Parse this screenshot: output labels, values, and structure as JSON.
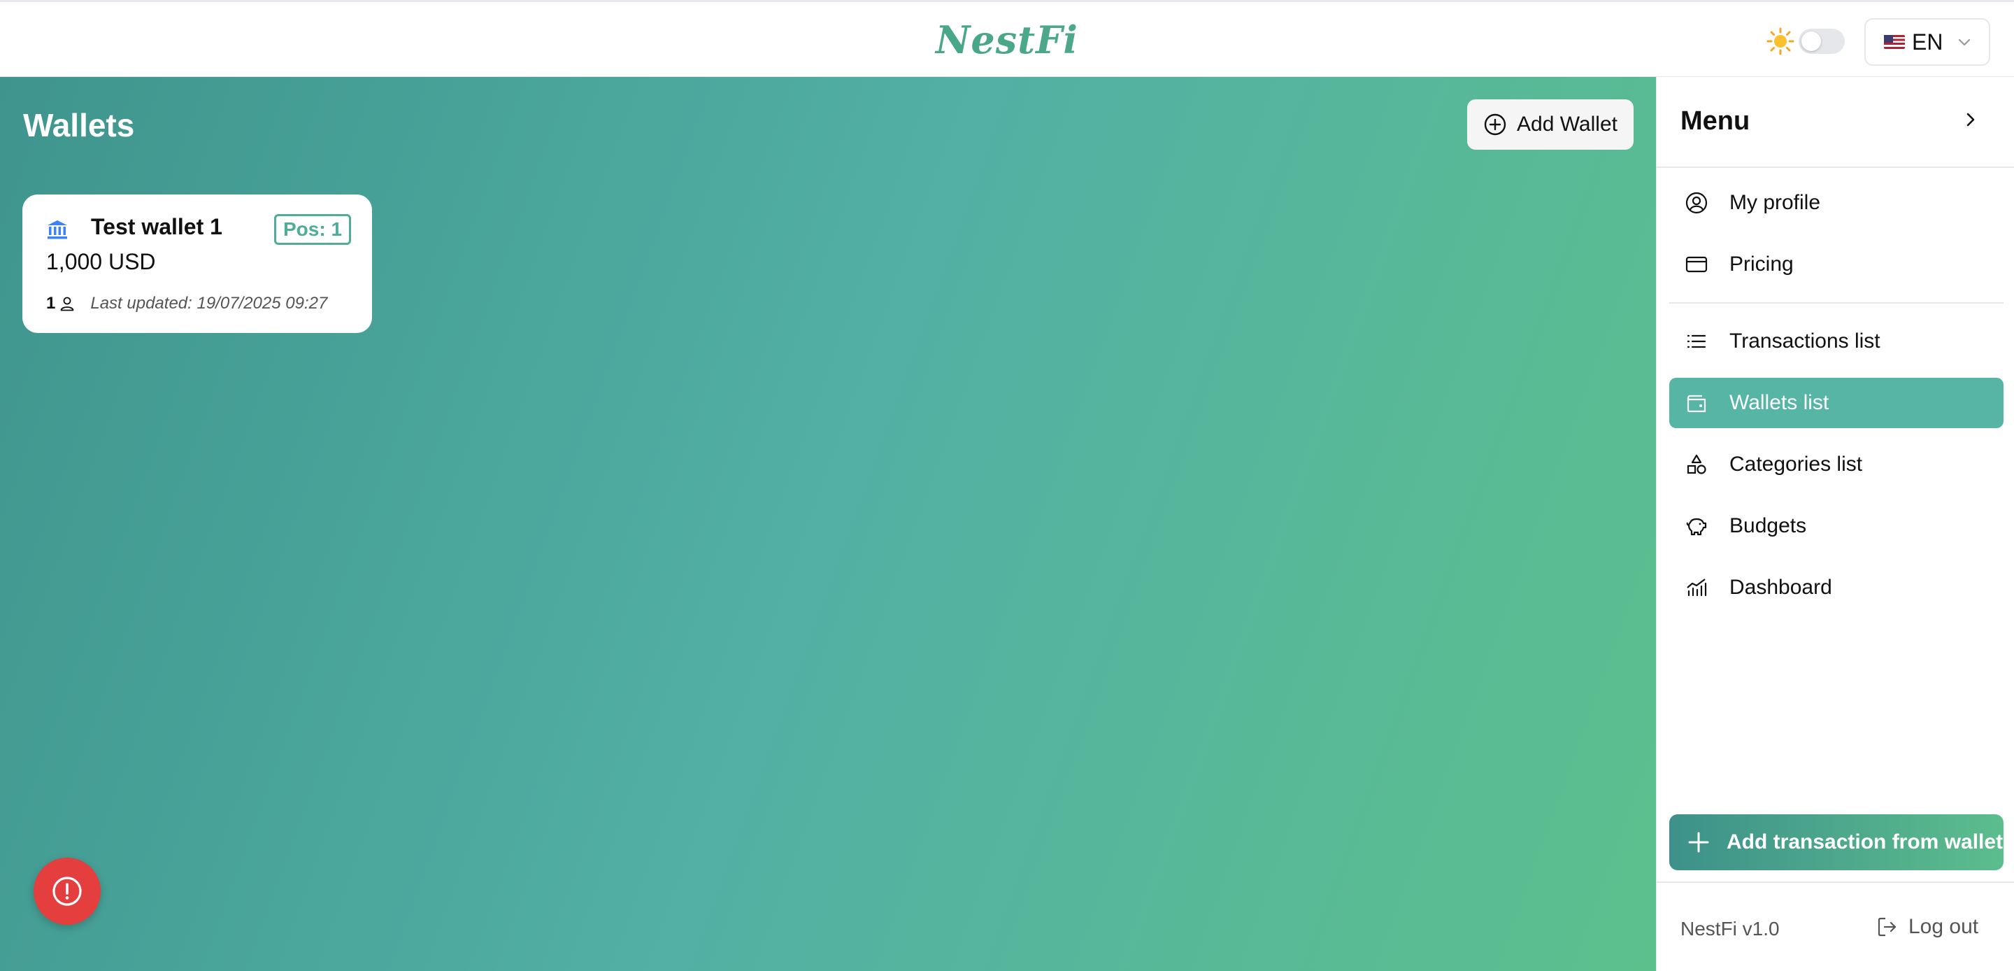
{
  "header": {
    "logo": "NestFi",
    "language": "EN"
  },
  "main": {
    "title": "Wallets",
    "add_wallet_label": "Add Wallet",
    "wallets": [
      {
        "name": "Test wallet 1",
        "position": "Pos: 1",
        "amount": "1,000 USD",
        "members": "1",
        "last_updated": "Last updated: 19/07/2025 09:27"
      }
    ]
  },
  "sidebar": {
    "title": "Menu",
    "items": [
      {
        "label": "My profile",
        "icon": "user-circle-icon",
        "active": false
      },
      {
        "label": "Pricing",
        "icon": "credit-card-icon",
        "active": false
      },
      {
        "label": "Transactions list",
        "icon": "list-icon",
        "active": false
      },
      {
        "label": "Wallets list",
        "icon": "wallet-icon",
        "active": true
      },
      {
        "label": "Categories list",
        "icon": "shapes-icon",
        "active": false
      },
      {
        "label": "Budgets",
        "icon": "piggy-bank-icon",
        "active": false
      },
      {
        "label": "Dashboard",
        "icon": "chart-icon",
        "active": false
      }
    ],
    "add_transaction_label": "Add transaction from wallet",
    "version": "NestFi v1.0",
    "logout_label": "Log out"
  },
  "colors": {
    "accent": "#56b5a4",
    "gradient_start": "#3f958d",
    "gradient_end": "#5cc08d",
    "alert": "#e53e3e"
  }
}
